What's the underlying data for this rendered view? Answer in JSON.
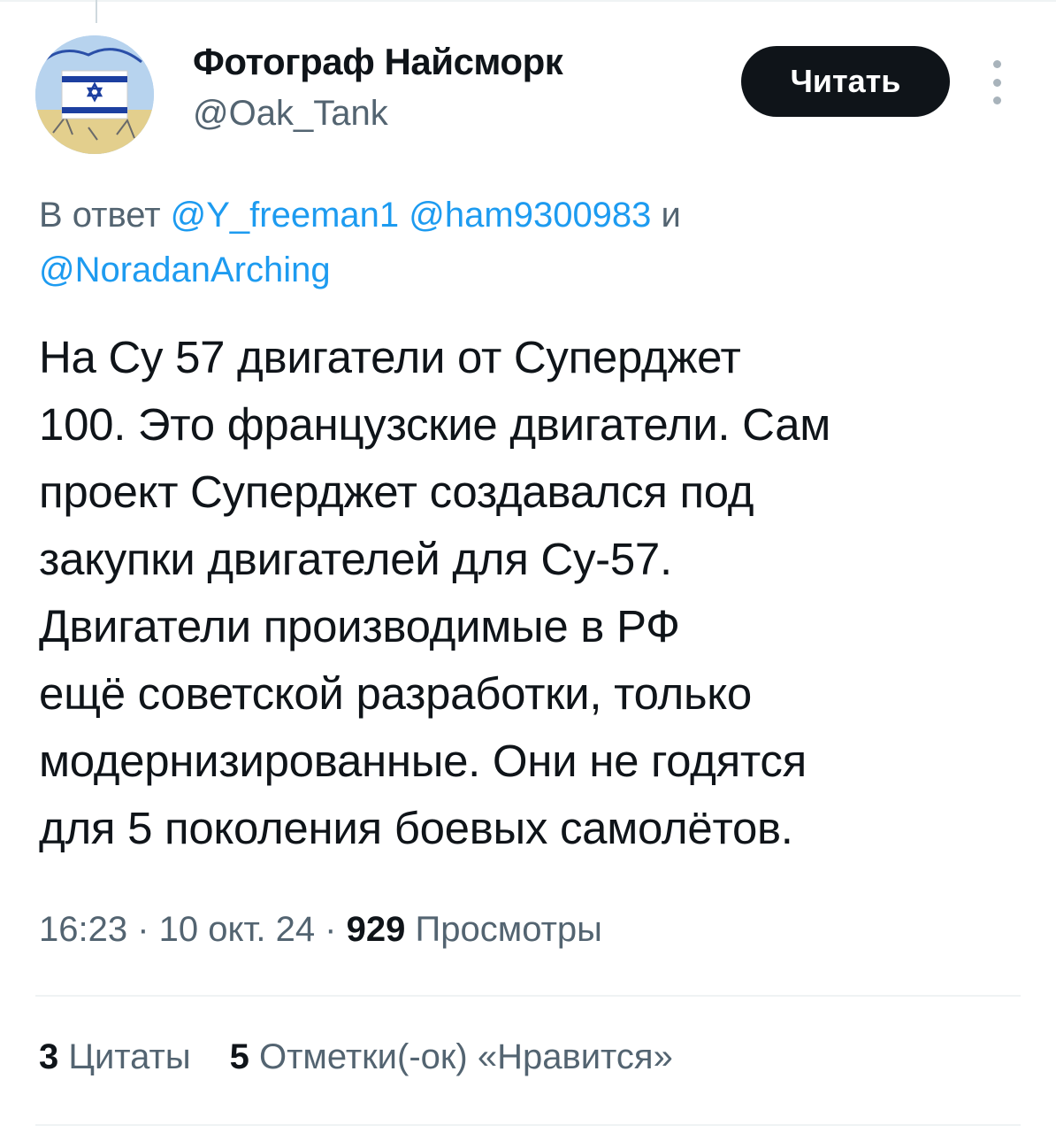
{
  "author": {
    "display_name": "Фотограф Найсморк",
    "handle": "@Oak_Tank",
    "avatar_icon": "israel-flag-avatar"
  },
  "follow_label": "Читать",
  "reply": {
    "prefix": "В ответ ",
    "mention_1": "@Y_freeman1",
    "mention_2": "@ham9300983",
    "conjunction": " и",
    "mention_3": "@NoradanArching"
  },
  "tweet": {
    "lines": [
      "На Су 57 двигатели от Суперджет",
      "100. Это французские двигатели. Сам",
      "проект Суперджет создавался под",
      "закупки двигателей для Су-57.",
      "Двигатели производимые в РФ",
      "ещё советской разработки, только",
      "модернизированные. Они не годятся",
      "для 5 поколения боевых самолётов."
    ]
  },
  "meta": {
    "time": "16:23",
    "separator": " · ",
    "date": "10 окт. 24",
    "views_count": "929",
    "views_label": "Просмотры"
  },
  "stats": {
    "quotes_count": "3",
    "quotes_label": "Цитаты",
    "likes_count": "5",
    "likes_label": "Отметки(-ок) «Нравится»"
  },
  "colors": {
    "text": "#0f1419",
    "secondary": "#536471",
    "link": "#1d9bf0",
    "button": "#0f1419",
    "divider": "#eff3f4"
  }
}
